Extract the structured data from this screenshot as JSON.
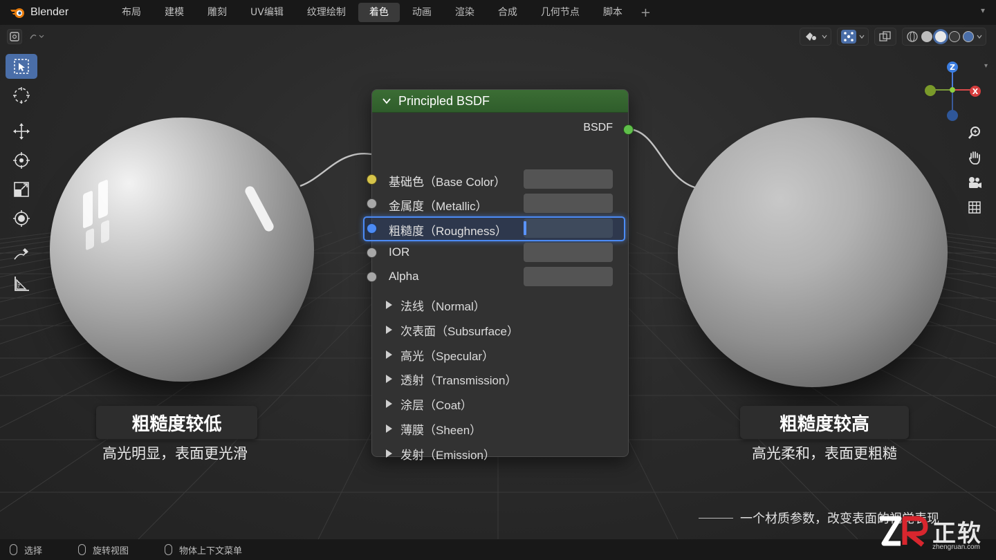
{
  "app": {
    "name": "Blender"
  },
  "tabs": [
    {
      "label": "布局",
      "active": false
    },
    {
      "label": "建模",
      "active": false
    },
    {
      "label": "雕刻",
      "active": false
    },
    {
      "label": "UV编辑",
      "active": false
    },
    {
      "label": "纹理绘制",
      "active": false
    },
    {
      "label": "着色",
      "active": true
    },
    {
      "label": "动画",
      "active": false
    },
    {
      "label": "渲染",
      "active": false
    },
    {
      "label": "合成",
      "active": false
    },
    {
      "label": "几何节点",
      "active": false
    },
    {
      "label": "脚本",
      "active": false
    }
  ],
  "tab_add": "+",
  "gizmo": {
    "z": "Z",
    "x": "X"
  },
  "node": {
    "title": "Principled BSDF",
    "output": "BSDF",
    "inputs": [
      {
        "label": "基础色（Base Color）",
        "socket_color": "#d6c44a"
      },
      {
        "label": "金属度（Metallic）",
        "socket_color": "#a8a8a8"
      },
      {
        "label": "粗糙度（Roughness）",
        "socket_color": "#4c8bf5",
        "highlighted": true
      },
      {
        "label": "IOR",
        "socket_color": "#a8a8a8"
      },
      {
        "label": "Alpha",
        "socket_color": "#a8a8a8"
      }
    ],
    "panels": [
      "法线（Normal）",
      "次表面（Subsurface）",
      "高光（Specular）",
      "透射（Transmission）",
      "涂层（Coat）",
      "薄膜（Sheen）",
      "发射（Emission）"
    ]
  },
  "captions": {
    "left": {
      "title": "粗糙度较低",
      "subtitle": "高光明显，表面更光滑"
    },
    "right": {
      "title": "粗糙度较高",
      "subtitle": "高光柔和，表面更粗糙"
    }
  },
  "tagline": "一个材质参数，改变表面的视觉表现",
  "status": [
    "选择",
    "旋转视图",
    "物体上下文菜单"
  ],
  "watermark": {
    "logo": "ZR",
    "name": "正软",
    "url": "zhengruan.com"
  },
  "colors": {
    "accent": "#4c8bf5",
    "node_header": "#3b6d34",
    "output_socket": "#5fbf4a"
  }
}
